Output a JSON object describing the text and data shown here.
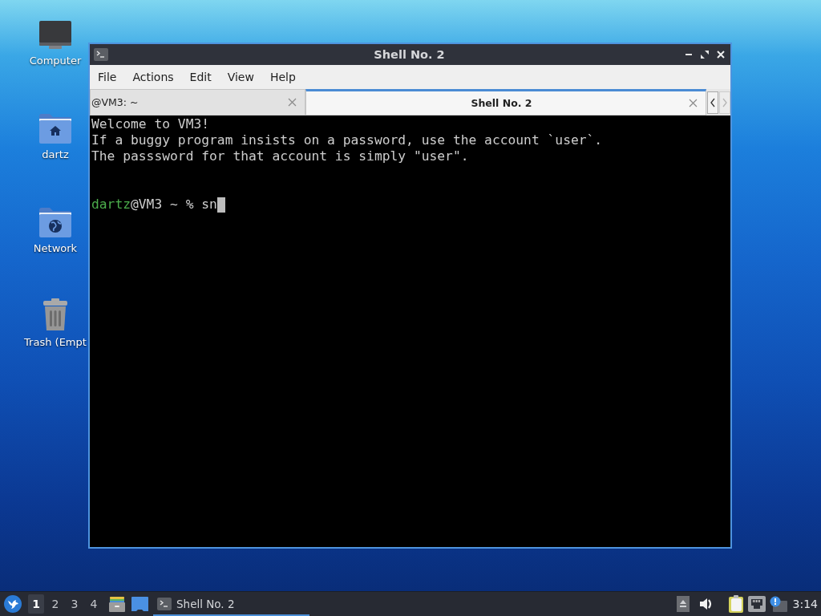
{
  "desktop": {
    "icons": [
      {
        "label": "Computer",
        "kind": "computer"
      },
      {
        "label": "dartz",
        "kind": "home"
      },
      {
        "label": "Network",
        "kind": "network"
      },
      {
        "label": "Trash (Empt",
        "kind": "trash"
      }
    ]
  },
  "window": {
    "title": "Shell No. 2",
    "menu": [
      "File",
      "Actions",
      "Edit",
      "View",
      "Help"
    ],
    "tabs": [
      {
        "label": "@VM3: ~",
        "selected": false
      },
      {
        "label": "Shell No. 2",
        "selected": true
      }
    ],
    "tab_scroll": [
      {
        "kind": "left",
        "disabled": false
      },
      {
        "kind": "right",
        "disabled": true
      }
    ],
    "terminal": {
      "lines": [
        "Welcome to VM3!",
        "If a buggy program insists on a password, use the account `user`.",
        "The passsword for that account is simply \"user\"."
      ],
      "prompt": {
        "user": "dartz",
        "text": "@VM3 ~ % sn"
      }
    }
  },
  "taskbar": {
    "workspaces": [
      {
        "label": "1",
        "selected": true
      },
      {
        "label": "2",
        "selected": false
      },
      {
        "label": "3",
        "selected": false
      },
      {
        "label": "4",
        "selected": false
      }
    ],
    "tasks": [
      {
        "label": "Shell No. 2",
        "selected": true
      }
    ],
    "clock": "3:14"
  }
}
